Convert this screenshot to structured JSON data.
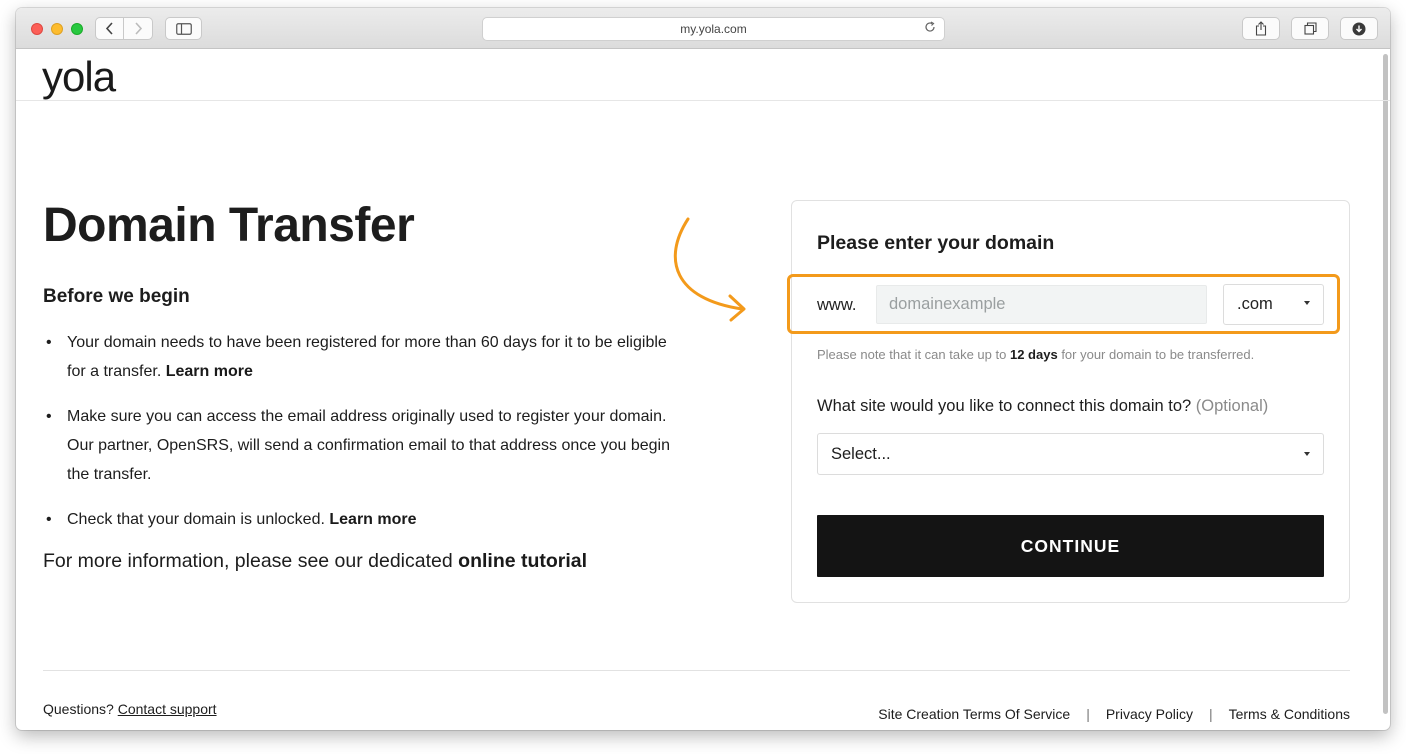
{
  "browser": {
    "url": "my.yola.com",
    "back_icon": "chevron-left-icon",
    "forward_icon": "chevron-right-icon",
    "sidebar_icon": "sidebar-icon",
    "reload_icon": "reload-icon",
    "share_icon": "share-icon",
    "tabs_icon": "tabs-icon",
    "downloads_icon": "download-icon"
  },
  "header": {
    "logo": "yola"
  },
  "intro": {
    "title": "Domain Transfer",
    "subheading": "Before we begin",
    "requirements": [
      {
        "text": "Your domain needs to have been registered for more than 60 days for it to be eligible for a transfer.",
        "link": "Learn more"
      },
      {
        "text": "Make sure you can access the email address originally used to register your domain. Our partner, OpenSRS, will send a confirmation email to that address once you begin the transfer.",
        "link": ""
      },
      {
        "text": "Check that your domain is unlocked.",
        "link": "Learn more"
      }
    ],
    "more_info_prefix": "For more information, please see our dedicated",
    "more_info_link": "online tutorial"
  },
  "form": {
    "title": "Please enter your domain",
    "www_label": "www.",
    "domain_placeholder": "domainexample",
    "tld_selected": ".com",
    "note_prefix": "Please note that it can take up to",
    "note_bold": "12 days",
    "note_suffix": "for your domain to be transferred.",
    "site_question": "What site would you like to connect this domain to?",
    "site_optional": "(Optional)",
    "site_selected": "Select...",
    "continue_label": "CONTINUE",
    "highlight_color": "#f39a1b"
  },
  "footer": {
    "questions_prefix": "Questions?",
    "contact_link": "Contact support",
    "links": [
      "Site Creation Terms Of Service",
      "Privacy Policy",
      "Terms & Conditions"
    ],
    "separator": "|"
  }
}
